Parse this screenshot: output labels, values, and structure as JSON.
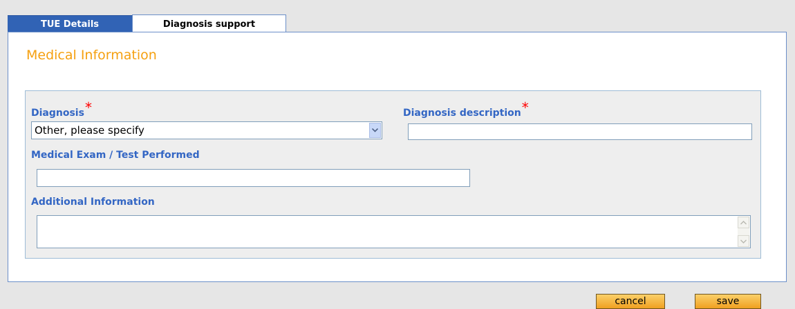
{
  "tabs": [
    {
      "label": "TUE Details"
    },
    {
      "label": "Diagnosis support"
    }
  ],
  "section": {
    "title": "Medical Information"
  },
  "form": {
    "diagnosis": {
      "label": "Diagnosis",
      "required_marker": "*",
      "selected": "Other, please specify"
    },
    "diagnosis_description": {
      "label": "Diagnosis description",
      "required_marker": "*",
      "value": ""
    },
    "medical_exam": {
      "label": "Medical Exam / Test Performed",
      "value": ""
    },
    "additional_info": {
      "label": "Additional Information",
      "value": ""
    }
  },
  "buttons": {
    "cancel": "cancel",
    "save": "save"
  },
  "colors": {
    "active_tab": "#3163b5",
    "label": "#3366c4",
    "title": "#f5a010",
    "required": "#ff0000",
    "button": "#f0a020"
  },
  "icons": {
    "dropdown": "chevron-down-icon",
    "scroll_up": "scroll-up-icon",
    "scroll_down": "scroll-down-icon"
  }
}
